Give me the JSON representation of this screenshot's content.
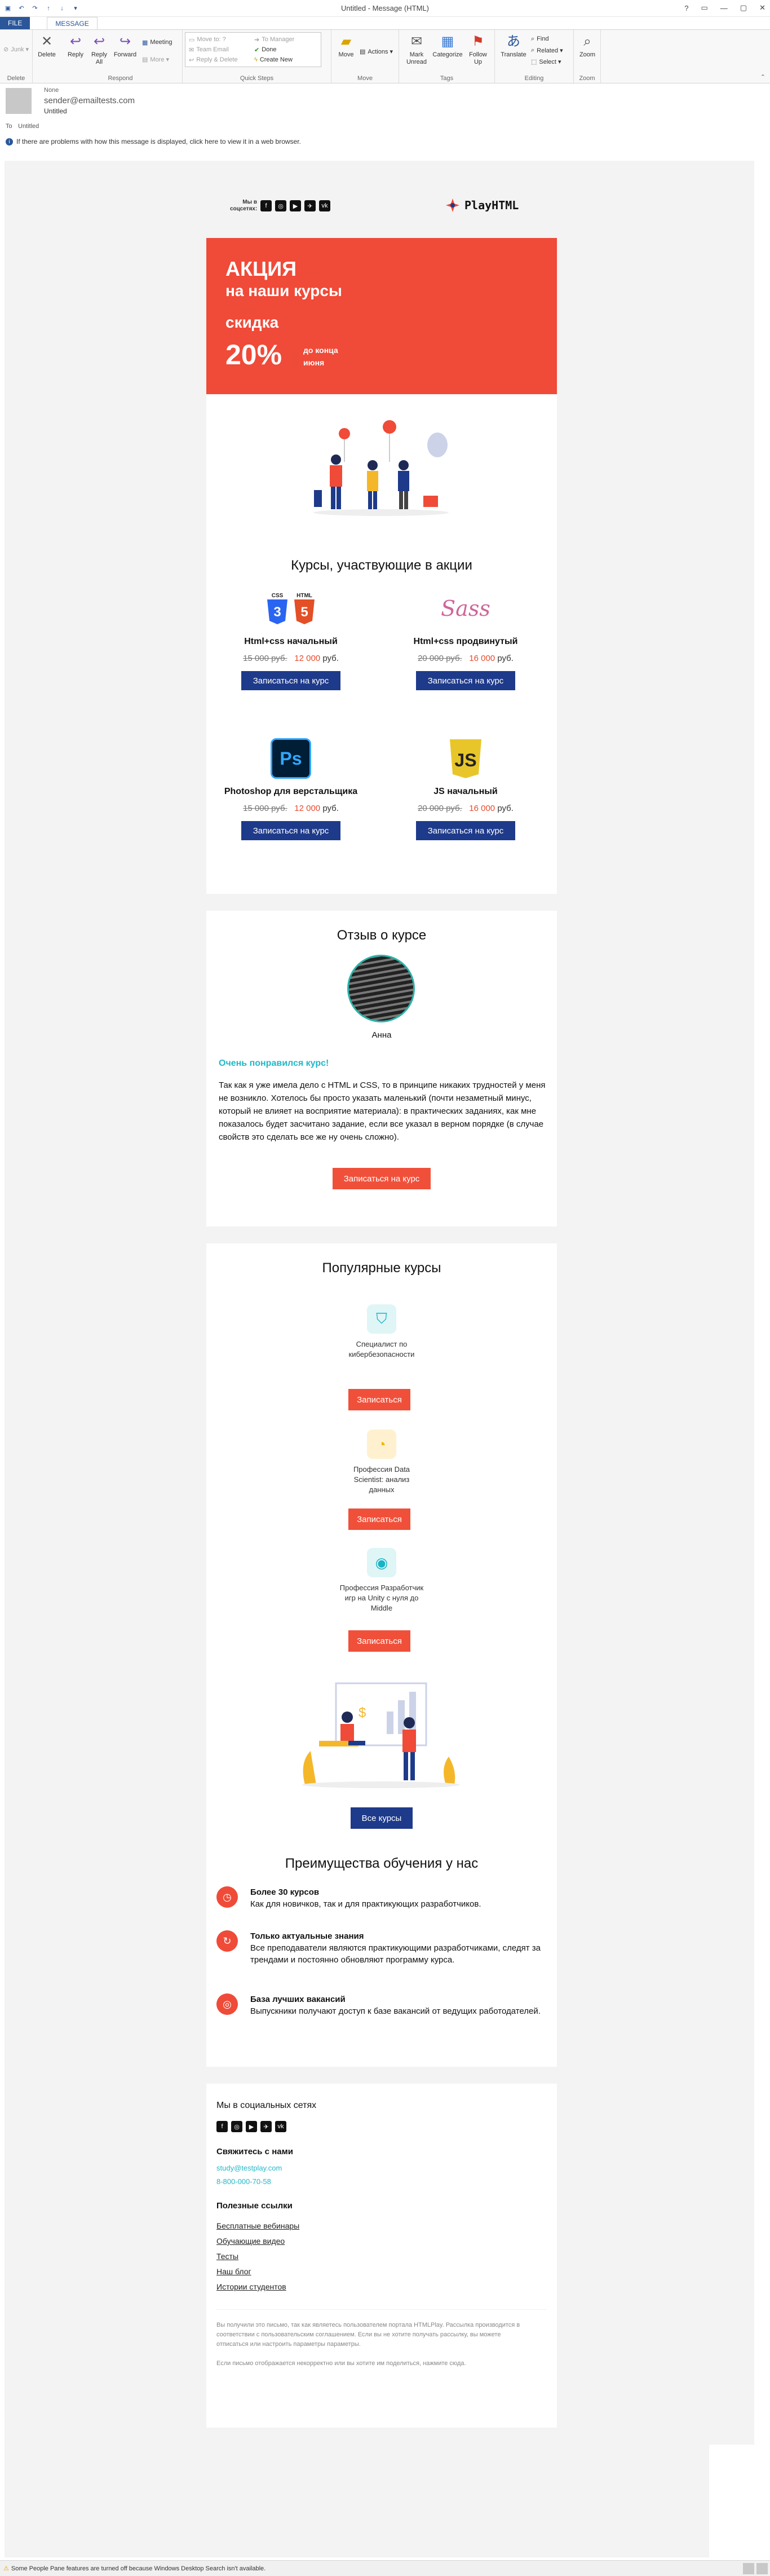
{
  "window": {
    "title": "Untitled - Message (HTML)",
    "controls": [
      "?",
      "▭",
      "—",
      "▢",
      "✕"
    ]
  },
  "tabs": [
    "FILE",
    "MESSAGE"
  ],
  "ribbon": {
    "delete": {
      "junk": "Junk ▾",
      "delete": "Delete",
      "label": "Delete"
    },
    "respond": {
      "reply": "Reply",
      "reply_all": "Reply All",
      "forward": "Forward",
      "meeting": "Meeting",
      "more": "More ▾",
      "label": "Respond"
    },
    "quick_steps": {
      "items": [
        "Move to: ?",
        "Team Email",
        "Reply & Delete",
        "To Manager",
        "Done",
        "Create New"
      ],
      "label": "Quick Steps"
    },
    "move": {
      "move": "Move",
      "actions": "Actions ▾",
      "label": "Move"
    },
    "tags": {
      "unread": "Mark Unread",
      "categorize": "Categorize",
      "follow": "Follow Up",
      "label": "Tags"
    },
    "editing": {
      "translate": "Translate",
      "find": "Find",
      "related": "Related ▾",
      "select": "Select ▾",
      "label": "Editing"
    },
    "zoom": {
      "zoom": "Zoom",
      "label": "Zoom"
    }
  },
  "header": {
    "date": "None",
    "from": "sender@emailtests.com",
    "subject": "Untitled",
    "to_label": "To",
    "to": "Untitled"
  },
  "infobar": "If there are problems with how this message is displayed, click here to view it in a web browser.",
  "email": {
    "top": {
      "social_label": "Мы в соцсетях:",
      "logo": "PlayHTML",
      "icons": [
        "f",
        "◎",
        "▶",
        "✈",
        "vk"
      ]
    },
    "banner": {
      "line1": "АКЦИЯ",
      "line2": "на наши курсы",
      "line3": "скидка",
      "percent": "20%",
      "until": "до конца июня"
    },
    "courses": {
      "title": "Курсы, участвующие в акции",
      "button": "Записаться на курс",
      "items": [
        {
          "name": "Html+css начальный",
          "old": "15 000 руб.",
          "new": "12 000",
          "cur": "руб."
        },
        {
          "name": "Html+css продвинутый",
          "old": "20 000 руб.",
          "new": "16 000",
          "cur": "руб."
        },
        {
          "name": "Photoshop для верстальщика",
          "old": "15 000 руб.",
          "new": "12 000",
          "cur": "руб."
        },
        {
          "name": "JS начальный",
          "old": "20 000 руб.",
          "new": "16 000",
          "cur": "руб."
        }
      ]
    },
    "review": {
      "title": "Отзыв о курсе",
      "author": "Анна",
      "headline": "Очень понравился курс!",
      "text": "Так как я уже имела дело с HTML и CSS, то в принципе никаких трудностей у меня не возникло. Хотелось бы просто указать маленький (почти незаметный минус, который не влияет на восприятие материала): в практических заданиях, как мне показалось будет засчитано задание, если все указал в верном порядке (в случае свойств это сделать все же ну очень сложно).",
      "button": "Записаться на курс"
    },
    "popular": {
      "title": "Популярные курсы",
      "button": "Записаться",
      "items": [
        {
          "name": "Специалист по кибербезопасности"
        },
        {
          "name": "Профессия Data Scientist: анализ данных"
        },
        {
          "name": "Профессия Разработчик игр на Unity с нуля до Middle"
        }
      ],
      "all": "Все курсы"
    },
    "advantages": {
      "title": "Преимущества обучения у нас",
      "items": [
        {
          "head": "Более 30 курсов",
          "text": "Как для новичков, так и для практикующих разработчиков."
        },
        {
          "head": "Только актуальные знания",
          "text": "Все преподаватели являются практикующими разработчиками, следят за трендами и постоянно обновляют программу курса."
        },
        {
          "head": "База лучших вакансий",
          "text": "Выпускники получают доступ к базе вакансий от ведущих работодателей."
        }
      ]
    },
    "footer": {
      "social": "Мы в социальных сетях",
      "contact": "Свяжитесь с нами",
      "email": "study@testplay.com",
      "phone": "8-800-000-70-58",
      "links_title": "Полезные ссылки",
      "links": [
        "Бесплатные вебинары",
        "Обучающие видео",
        "Тесты",
        "Наш блог",
        "Истории студентов"
      ],
      "legal1": "Вы получили это письмо, так как являетесь пользователем портала HTMLPlay. Рассылка производится в соответствии с пользовательским соглашением. Если вы не хотите получать рассылку, вы можете отписаться или настроить параметры параметры.",
      "legal2": "Если письмо отображается некорректно или вы хотите им поделиться, нажмите сюда."
    }
  },
  "status": "Some People Pane features are turned off because Windows Desktop Search isn't available."
}
